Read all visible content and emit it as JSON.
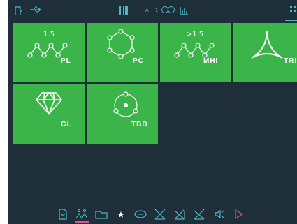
{
  "topbar": {
    "icons": [
      "door-icon",
      "usb-icon",
      "barcode-icon",
      "dual-circle-icon",
      "chart-icon",
      "grid-menu-icon"
    ],
    "label": "A - 1"
  },
  "tiles": [
    {
      "id": "pl",
      "top_label": "1.5",
      "code": "PL",
      "icon": "zigzag-molecule-icon"
    },
    {
      "id": "pc",
      "top_label": "",
      "code": "PC",
      "icon": "ring-molecule-icon"
    },
    {
      "id": "mhi",
      "top_label": ">1.5",
      "code": "MHI",
      "icon": "zigzag-molecule-icon"
    },
    {
      "id": "tri",
      "top_label": "",
      "code": "TRI",
      "icon": "tri-arc-icon"
    },
    {
      "id": "gl",
      "top_label": "",
      "code": "GL",
      "icon": "diamond-icon"
    },
    {
      "id": "tbd",
      "top_label": "",
      "code": "TBD",
      "icon": "circle-nodes-icon"
    }
  ],
  "bottombar": {
    "items": [
      {
        "name": "document-icon",
        "active": false
      },
      {
        "name": "molecule-icon",
        "active": true
      },
      {
        "name": "folder-icon",
        "active": false
      },
      {
        "name": "star-icon",
        "active": false
      },
      {
        "name": "speech-icon",
        "active": false
      },
      {
        "name": "cross-box-icon",
        "active": false
      },
      {
        "name": "slash-box-icon",
        "active": false
      },
      {
        "name": "slash-box-2-icon",
        "active": false
      },
      {
        "name": "speaker-icon",
        "active": false
      },
      {
        "name": "play-icon",
        "active": false
      }
    ]
  },
  "colors": {
    "background": "#1f2f3a",
    "tile": "#3bb54a",
    "accent": "#4ab8c7",
    "active_underline": "#e0508a"
  }
}
